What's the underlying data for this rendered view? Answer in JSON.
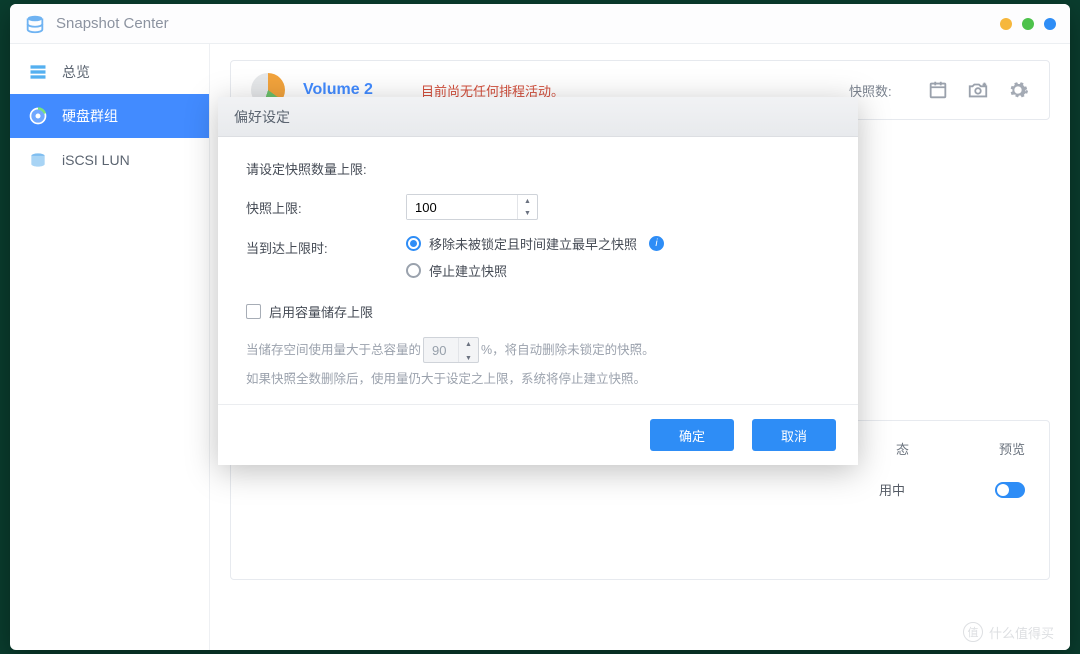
{
  "app": {
    "title": "Snapshot Center"
  },
  "sidebar": {
    "items": [
      {
        "label": "总览"
      },
      {
        "label": "硬盘群组"
      },
      {
        "label": "iSCSI LUN"
      }
    ]
  },
  "volume": {
    "name": "Volume 2",
    "status": "目前尚无任何排程活动。",
    "meta_label": "快照数:"
  },
  "table": {
    "col_status": "态",
    "col_preview": "预览",
    "val_status": "用中"
  },
  "modal": {
    "title": "偏好设定",
    "section": "请设定快照数量上限:",
    "limit_label": "快照上限:",
    "limit_value": "100",
    "reach_label": "当到达上限时:",
    "radio1": "移除未被锁定且时间建立最早之快照",
    "radio2": "停止建立快照",
    "checkbox": "启用容量储存上限",
    "help_pre": "当储存空间使用量大于总容量的",
    "help_pct_value": "90",
    "help_pct": "%，将自动删除未锁定的快照。",
    "help2": "如果快照全数删除后，使用量仍大于设定之上限，系统将停止建立快照。",
    "ok": "确定",
    "cancel": "取消"
  },
  "watermark": "什么值得买"
}
